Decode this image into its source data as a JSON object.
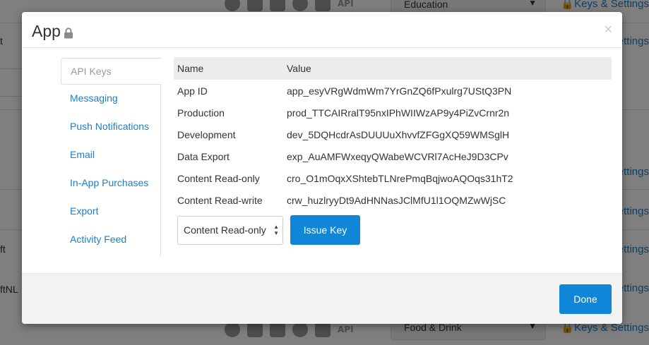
{
  "background": {
    "top_category": "Education",
    "bottom_category": "Food & Drink",
    "settings_link": "Settings",
    "keys_settings_link": "Keys & Settings",
    "api_label": "API",
    "left_fragments": [
      "t",
      "ft",
      "ftNL"
    ]
  },
  "modal": {
    "title": "App",
    "close_label": "×",
    "sidebar": {
      "items": [
        {
          "label": "API Keys"
        },
        {
          "label": "Messaging"
        },
        {
          "label": "Push Notifications"
        },
        {
          "label": "Email"
        },
        {
          "label": "In-App Purchases"
        },
        {
          "label": "Export"
        },
        {
          "label": "Activity Feed"
        }
      ]
    },
    "keys_table": {
      "headers": {
        "name": "Name",
        "value": "Value"
      },
      "rows": [
        {
          "name": "App ID",
          "value": "app_esyVRgWdmWm7YrGnZQ6fPxulrg7UStQ3PN"
        },
        {
          "name": "Production",
          "value": "prod_TTCAIRralT95nxIPhWIIWzAP9y4PiZvCrnr2n"
        },
        {
          "name": "Development",
          "value": "dev_5DQHcdrAsDUUUuXhvvfZFGgXQ59WMSglH"
        },
        {
          "name": "Data Export",
          "value": "exp_AuAMFWxeqyQWabeWCVRl7AcHeJ9D3CPv"
        },
        {
          "name": "Content Read-only",
          "value": "cro_O1mOqxXShtebTLNrePmqBqjwoAQOqs31hT2"
        },
        {
          "name": "Content Read-write",
          "value": "crw_huzlryyDt9AdHNNasJClMfU1l1OQMZwWjSC"
        }
      ]
    },
    "key_type_select": {
      "selected": "Content Read-only"
    },
    "issue_key_label": "Issue Key",
    "done_label": "Done"
  },
  "colors": {
    "accent": "#0f86d8",
    "link": "#1a7ec8"
  }
}
